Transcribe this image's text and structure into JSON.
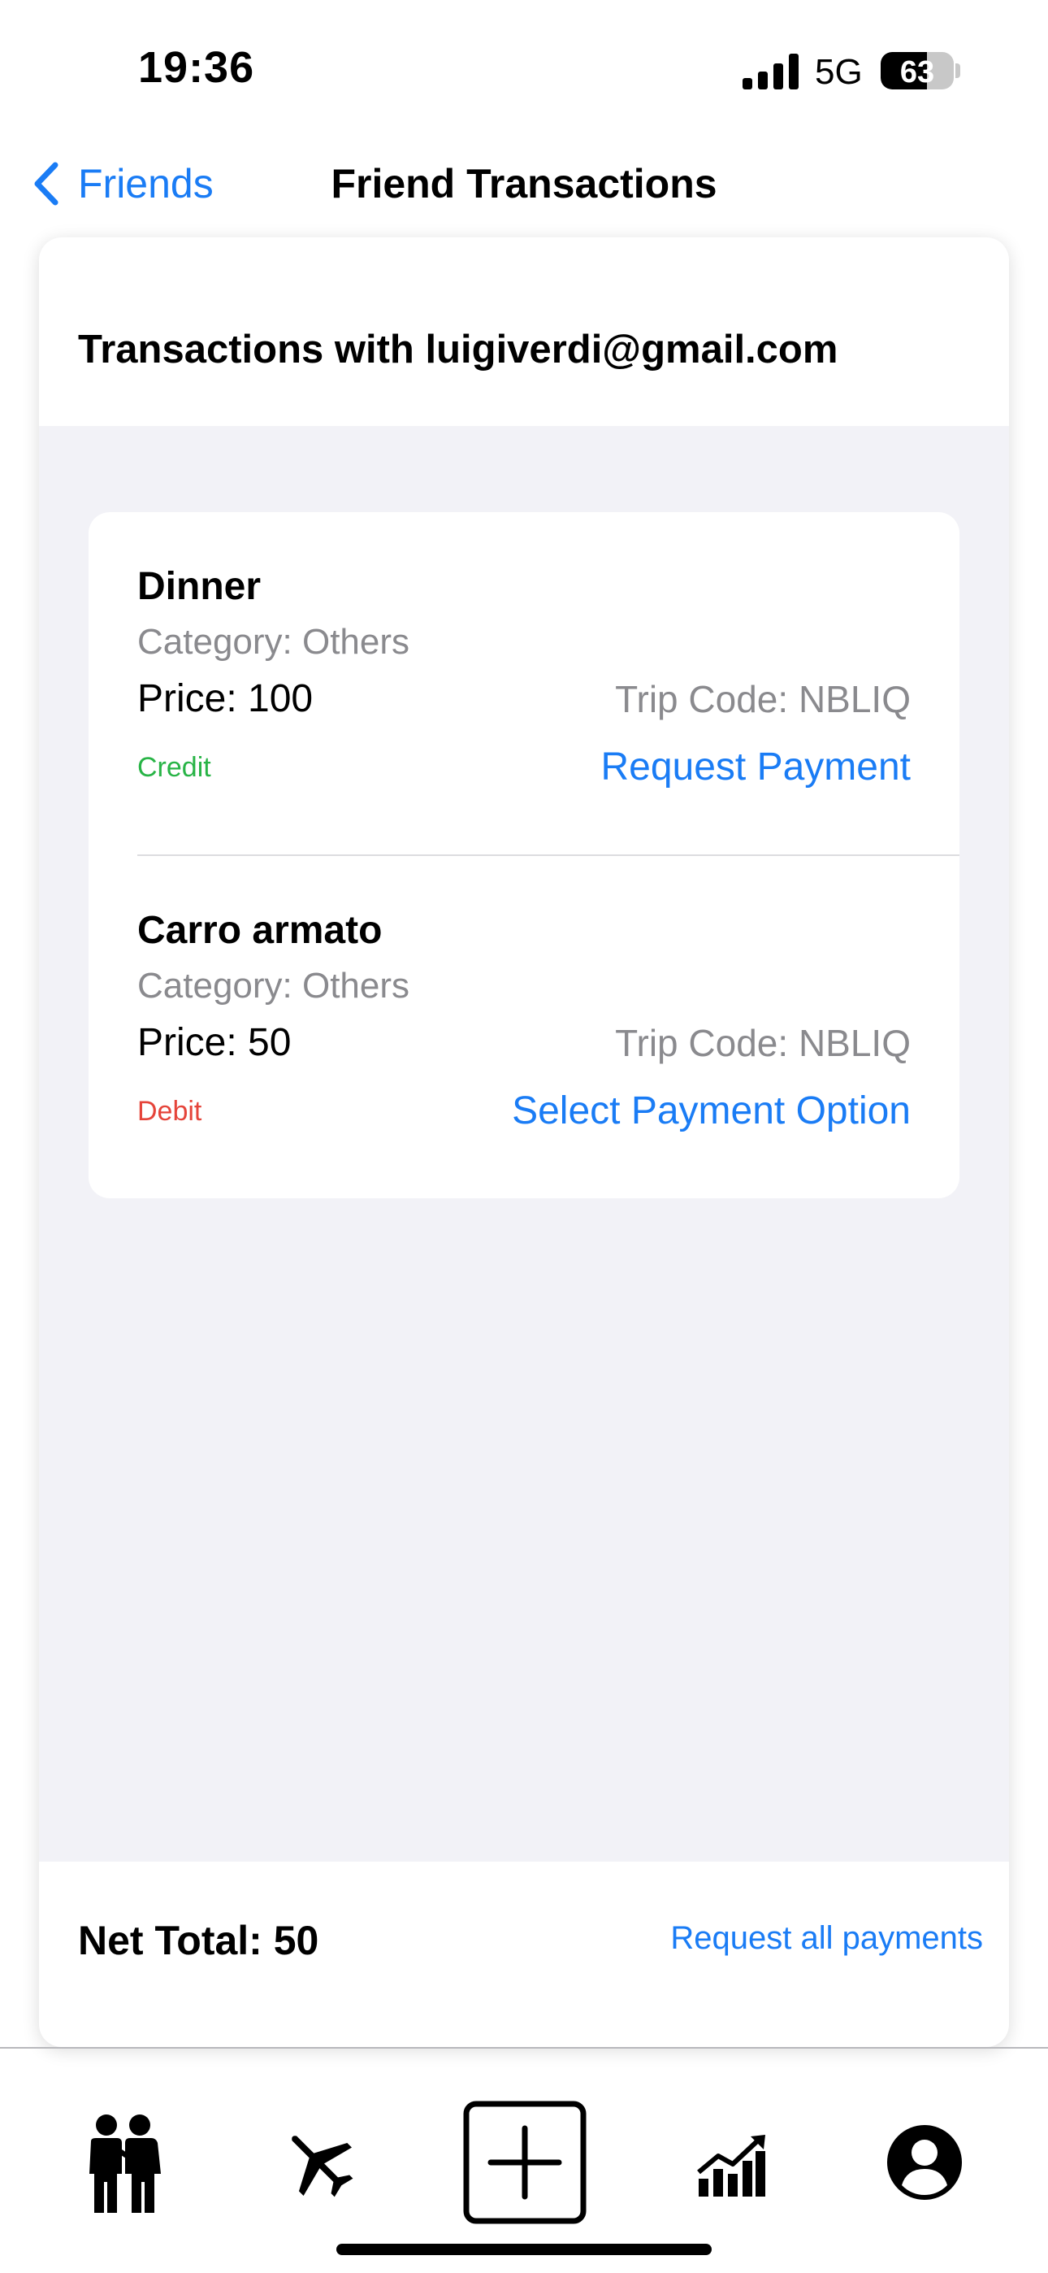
{
  "status_bar": {
    "time": "19:36",
    "network": "5G",
    "battery": "63",
    "battery_level": 0.63,
    "icons": [
      "signal-icon",
      "battery-icon"
    ]
  },
  "nav": {
    "back_label": "Friends",
    "title": "Friend Transactions",
    "back_icon": "chevron-left-icon"
  },
  "header": {
    "heading": "Transactions with luigiverdi@gmail.com"
  },
  "transactions": [
    {
      "title": "Dinner",
      "category": "Category: Others",
      "price": "Price: 100",
      "trip_code": "Trip Code: NBLIQ",
      "type": "Credit",
      "action": "Request Payment"
    },
    {
      "title": "Carro armato",
      "category": "Category: Others",
      "price": "Price: 50",
      "trip_code": "Trip Code: NBLIQ",
      "type": "Debit",
      "action": "Select Payment Option"
    }
  ],
  "footer": {
    "net_total": "Net Total: 50",
    "request_all": "Request all payments"
  },
  "tab_bar": {
    "icons": [
      "friends-icon",
      "plane-icon",
      "add-icon",
      "stats-chart-icon",
      "profile-icon"
    ]
  },
  "colors": {
    "accent": "#1a7cf5",
    "credit": "#28b446",
    "debit": "#e5443a",
    "secondary_text": "#8a8a8e",
    "background": "#f2f2f7"
  }
}
